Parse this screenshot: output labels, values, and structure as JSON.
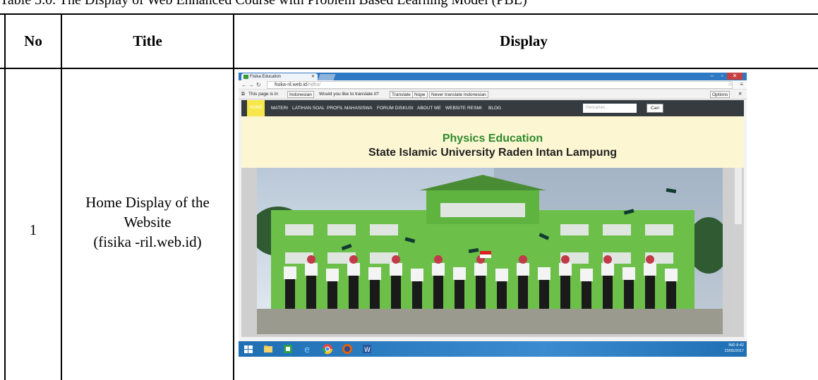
{
  "caption": "Table 3.0. The Display of Web Enhanced Course with Problem Based Learning Model (PBL)",
  "table": {
    "headers": {
      "no": "No",
      "title": "Title",
      "display": "Display"
    },
    "rows": [
      {
        "no": "1",
        "title_lines": [
          "Home Display of the",
          "Website",
          "(fisika -ril.web.id)"
        ]
      }
    ]
  },
  "screenshot": {
    "tab_title": "Fisika Education",
    "url_host": "fisika-ril.web.id",
    "url_path": "/ridho/",
    "translate_bar": {
      "prefix": "This page is in",
      "language": "Indonesian",
      "question": "Would you like to translate it?",
      "translate": "Translate",
      "nope": "Nope",
      "never": "Never translate Indonesian",
      "options": "Options"
    },
    "nav": {
      "home": "HOME",
      "items": [
        "MATERI",
        "LATIHAN SOAL",
        "PROFIL MAHASISWA",
        "FORUM DISKUSI",
        "ABOUT ME",
        "WEBSITE RESMI",
        "BLOG"
      ],
      "search_placeholder": "Pencarian...",
      "search_button": "Cari"
    },
    "banner": {
      "line1": "Physics Education",
      "line2": "State Islamic University Raden Intan Lampung"
    },
    "tray": {
      "lang": "IND",
      "time": "8:42",
      "date": "23/05/2017"
    }
  },
  "colors": {
    "nav_bg": "#353b3f",
    "home_tab": "#f6e84a",
    "banner_bg": "#fdf6d2",
    "banner_title": "#2d8a2d",
    "taskbar": "#2f80c8"
  }
}
